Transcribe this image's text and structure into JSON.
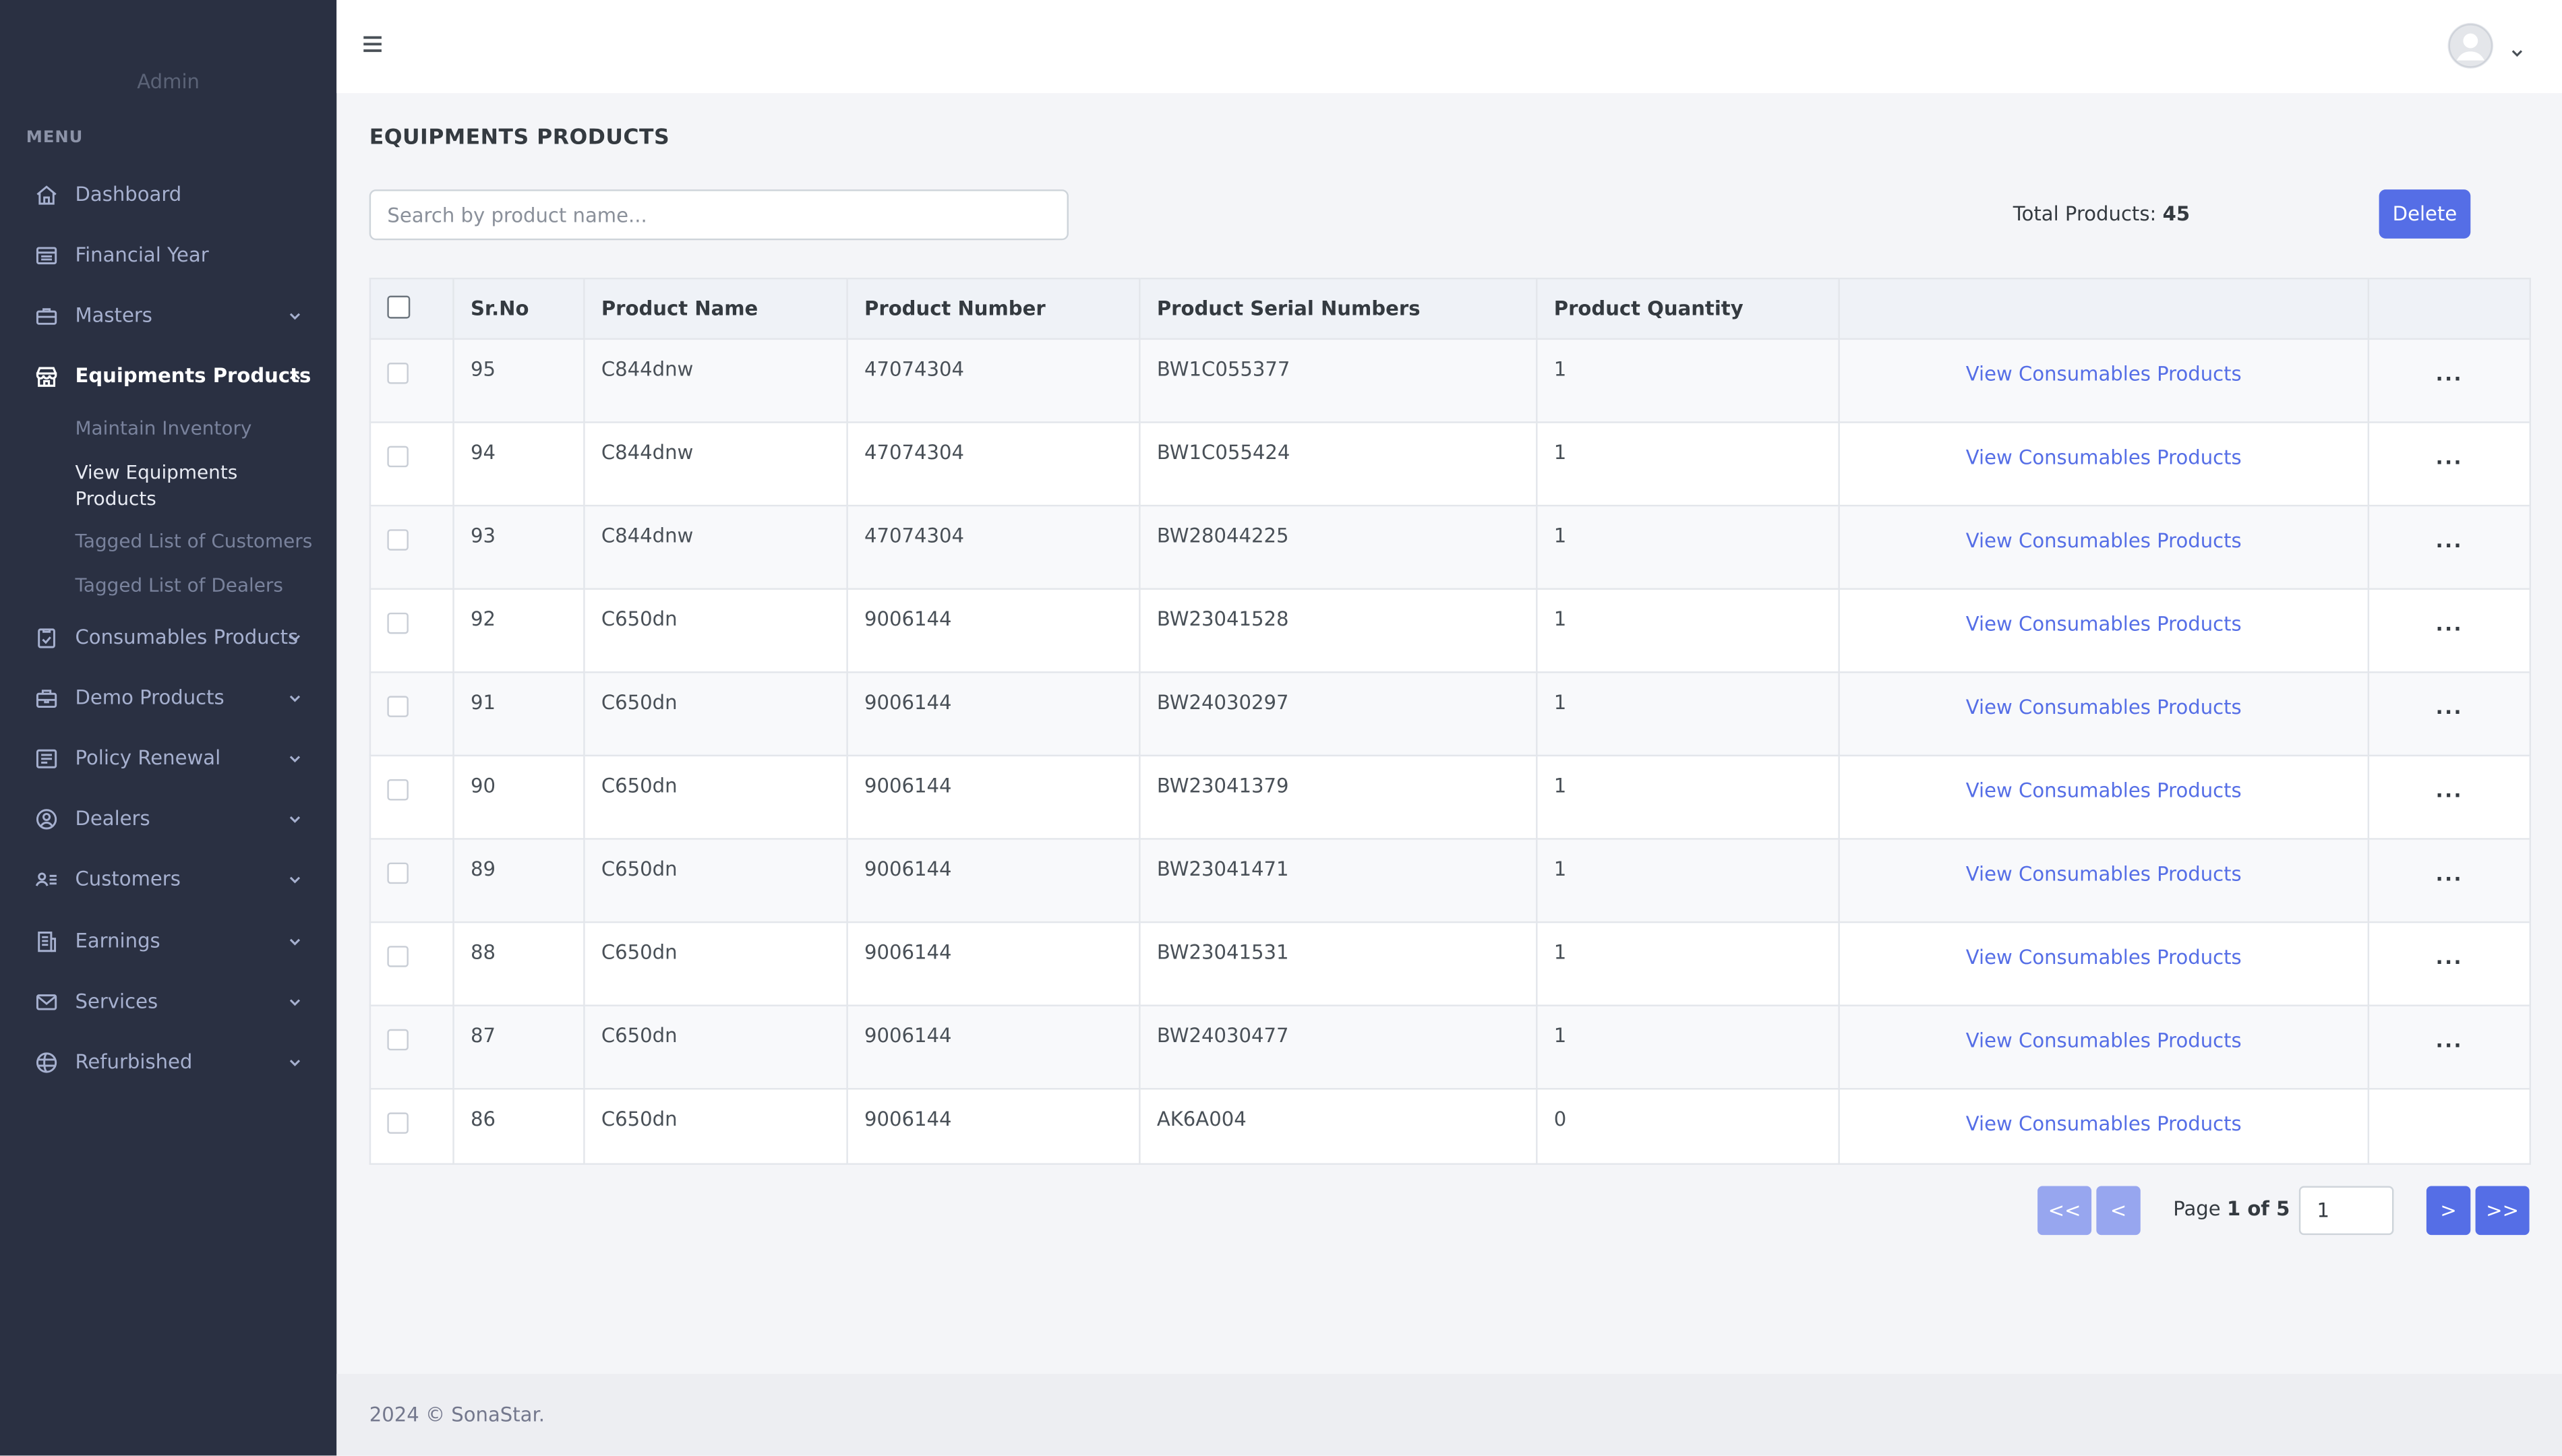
{
  "sidebar": {
    "brand": "Admin",
    "menu_title": "MENU",
    "items": [
      {
        "label": "Dashboard",
        "icon": "home-icon"
      },
      {
        "label": "Financial Year",
        "icon": "calendar-icon"
      },
      {
        "label": "Masters",
        "icon": "briefcase-icon"
      },
      {
        "label": "Equipments Products",
        "icon": "store-icon"
      },
      {
        "label": "Consumables Products",
        "icon": "clipboard-check-icon"
      },
      {
        "label": "Demo Products",
        "icon": "box-icon"
      },
      {
        "label": "Policy Renewal",
        "icon": "list-icon"
      },
      {
        "label": "Dealers",
        "icon": "user-circle-icon"
      },
      {
        "label": "Customers",
        "icon": "user-list-icon"
      },
      {
        "label": "Earnings",
        "icon": "receipt-icon"
      },
      {
        "label": "Services",
        "icon": "mail-icon"
      },
      {
        "label": "Refurbished",
        "icon": "globe-icon"
      }
    ],
    "submenu": [
      "Maintain Inventory",
      "View Equipments Products",
      "Tagged List of Customers",
      "Tagged List of Dealers"
    ]
  },
  "header": {
    "menu_icon": "hamburger-icon",
    "avatar_icon": "avatar-icon",
    "dropdown_icon": "chevron-down-icon"
  },
  "main": {
    "title": "EQUIPMENTS PRODUCTS",
    "search_placeholder": "Search by product name...",
    "total_label": "Total Products:",
    "total_value": "45",
    "delete_label": "Delete",
    "columns": [
      "Sr.No",
      "Product Name",
      "Product Number",
      "Product Serial Numbers",
      "Product Quantity"
    ],
    "link_label": "View Consumables Products",
    "more_label": "...",
    "rows": [
      {
        "srno": "95",
        "name": "C844dnw",
        "number": "47074304",
        "serial": "BW1C055377",
        "qty": "1",
        "has_menu": true
      },
      {
        "srno": "94",
        "name": "C844dnw",
        "number": "47074304",
        "serial": "BW1C055424",
        "qty": "1",
        "has_menu": true
      },
      {
        "srno": "93",
        "name": "C844dnw",
        "number": "47074304",
        "serial": "BW28044225",
        "qty": "1",
        "has_menu": true
      },
      {
        "srno": "92",
        "name": "C650dn",
        "number": "9006144",
        "serial": "BW23041528",
        "qty": "1",
        "has_menu": true
      },
      {
        "srno": "91",
        "name": "C650dn",
        "number": "9006144",
        "serial": "BW24030297",
        "qty": "1",
        "has_menu": true
      },
      {
        "srno": "90",
        "name": "C650dn",
        "number": "9006144",
        "serial": "BW23041379",
        "qty": "1",
        "has_menu": true
      },
      {
        "srno": "89",
        "name": "C650dn",
        "number": "9006144",
        "serial": "BW23041471",
        "qty": "1",
        "has_menu": true
      },
      {
        "srno": "88",
        "name": "C650dn",
        "number": "9006144",
        "serial": "BW23041531",
        "qty": "1",
        "has_menu": true
      },
      {
        "srno": "87",
        "name": "C650dn",
        "number": "9006144",
        "serial": "BW24030477",
        "qty": "1",
        "has_menu": true
      },
      {
        "srno": "86",
        "name": "C650dn",
        "number": "9006144",
        "serial": "AK6A004",
        "qty": "0",
        "has_menu": false
      }
    ]
  },
  "pagination": {
    "first": "<<",
    "prev": "<",
    "next": ">",
    "last": ">>",
    "page_prefix": "Page",
    "page_status": "1 of 5",
    "page_input": "1"
  },
  "footer": {
    "text": "2024 © SonaStar."
  },
  "colors": {
    "sidebar": "#2a3042",
    "accent": "#556ee6",
    "accent_disabled": "#97a6ef",
    "link": "#556ee6"
  }
}
